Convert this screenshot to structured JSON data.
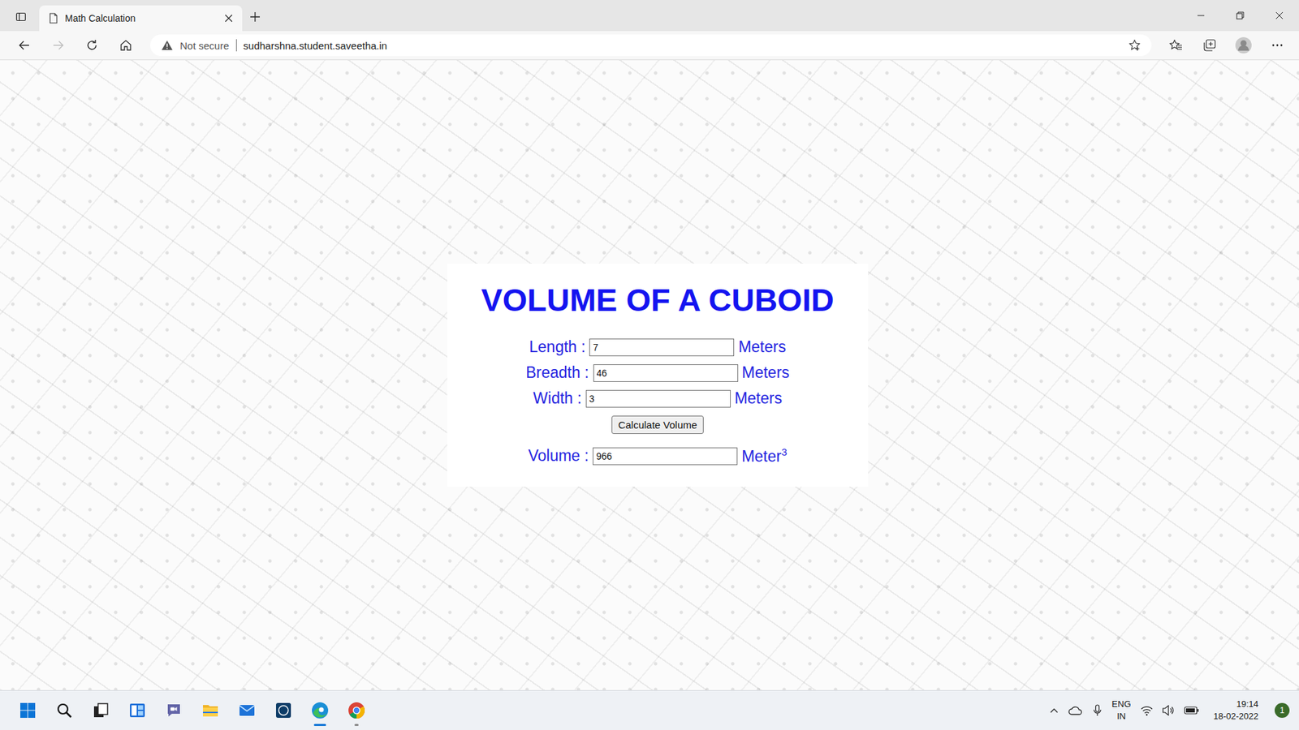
{
  "browser": {
    "tabs": [
      {
        "label": "Math Calculation",
        "selected": true
      }
    ],
    "address": {
      "security": "Not secure",
      "url": "sudharshna.student.saveetha.in"
    }
  },
  "page": {
    "title": "VOLUME OF A CUBOID",
    "fields": [
      {
        "label": "Length :",
        "value": "7",
        "unit": "Meters"
      },
      {
        "label": "Breadth :",
        "value": "46",
        "unit": "Meters"
      },
      {
        "label": "Width :",
        "value": "3",
        "unit": "Meters"
      }
    ],
    "button": "Calculate Volume",
    "result": {
      "label": "Volume :",
      "value": "966",
      "unit": "Meter",
      "exponent": "3"
    }
  },
  "taskbar": {
    "apps": [
      {
        "kind": "start",
        "running": false,
        "focused": false
      },
      {
        "kind": "search",
        "running": false,
        "focused": false
      },
      {
        "kind": "taskview",
        "running": false,
        "focused": false
      },
      {
        "kind": "widgets",
        "running": false,
        "focused": false
      },
      {
        "kind": "chat",
        "running": false,
        "focused": false
      },
      {
        "kind": "explorer",
        "running": false,
        "focused": false
      },
      {
        "kind": "mail",
        "running": false,
        "focused": false
      },
      {
        "kind": "dell",
        "running": false,
        "focused": false
      },
      {
        "kind": "edge",
        "running": true,
        "focused": true
      },
      {
        "kind": "chrome",
        "running": true,
        "focused": false
      }
    ],
    "tray": {
      "language": "ENG",
      "region": "IN",
      "time": "19:14",
      "date": "18-02-2022",
      "notifications": "1"
    }
  }
}
